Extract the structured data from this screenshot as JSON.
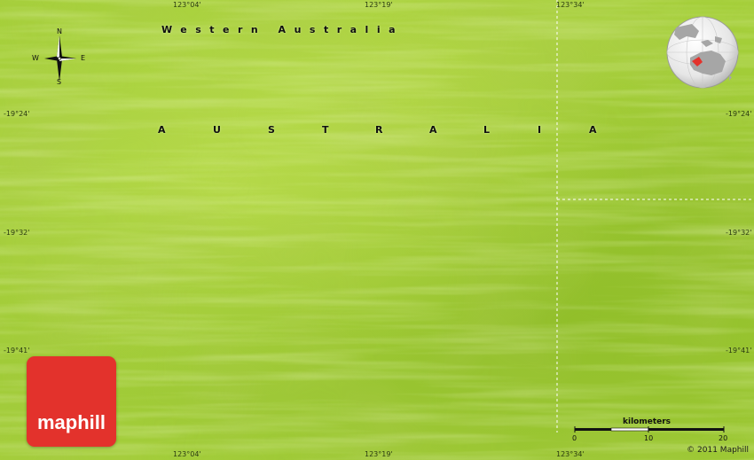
{
  "map": {
    "colors": {
      "land": "#9fca36",
      "border": "#ffffff",
      "logo": "#e3322c"
    },
    "region_label": "Western Australia",
    "country_label": [
      "A",
      "U",
      "S",
      "T",
      "R",
      "A",
      "L",
      "I",
      "A"
    ],
    "longitude_labels": {
      "top": [
        "123°04'",
        "123°19'",
        "123°34'"
      ],
      "bottom": [
        "123°04'",
        "123°19'",
        "123°34'"
      ]
    },
    "latitude_labels": {
      "left": [
        "-19°24'",
        "-19°32'",
        "-19°41'"
      ],
      "right": [
        "-19°24'",
        "-19°32'",
        "-19°41'"
      ]
    },
    "compass": {
      "north": "N",
      "south": "S",
      "east": "E",
      "west": "W",
      "icon": "compass-rose-icon"
    },
    "locator_globe": {
      "icon": "globe-icon",
      "highlight_region": "Western Australia"
    },
    "scale_bar": {
      "unit_label": "kilometers",
      "ticks": [
        "0",
        "10",
        "20"
      ]
    },
    "logo": {
      "text": "maphill"
    },
    "copyright": "© 2011 Maphill"
  }
}
